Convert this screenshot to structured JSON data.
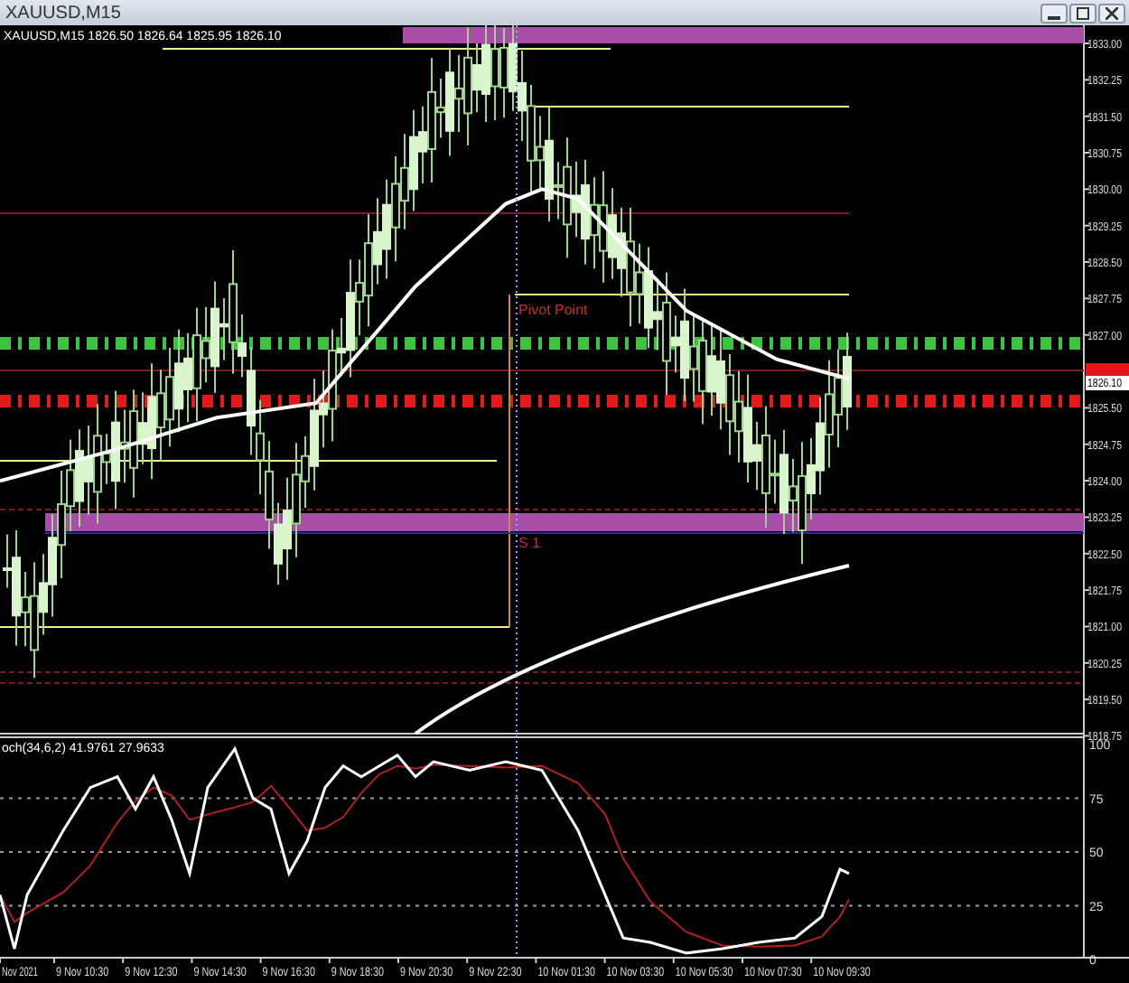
{
  "window": {
    "title": "XAUUSD,M15"
  },
  "chart": {
    "header": "XAUUSD,M15  1826.50 1826.64 1825.95 1826.10",
    "price_axis": [
      "1833.00",
      "1832.25",
      "1831.50",
      "1830.75",
      "1830.00",
      "1829.25",
      "1828.50",
      "1827.75",
      "1827.00",
      "1825.50",
      "1824.75",
      "1824.00",
      "1823.25",
      "1822.50",
      "1821.75",
      "1821.00",
      "1820.25",
      "1819.50",
      "1818.75"
    ],
    "bid_label": "1826.10",
    "annotations": [
      "Pivot Point",
      "S 1"
    ]
  },
  "indicator": {
    "label": "och(34,6,2) 41.9761 27.9633",
    "axis": [
      "100",
      "75",
      "50",
      "25",
      "0"
    ]
  },
  "time_axis": [
    "Nov 2021",
    "9 Nov 10:30",
    "9 Nov 12:30",
    "9 Nov 14:30",
    "9 Nov 16:30",
    "9 Nov 18:30",
    "9 Nov 20:30",
    "9 Nov 22:30",
    "10 Nov 01:30",
    "10 Nov 03:30",
    "10 Nov 05:30",
    "10 Nov 07:30",
    "10 Nov 09:30"
  ]
}
